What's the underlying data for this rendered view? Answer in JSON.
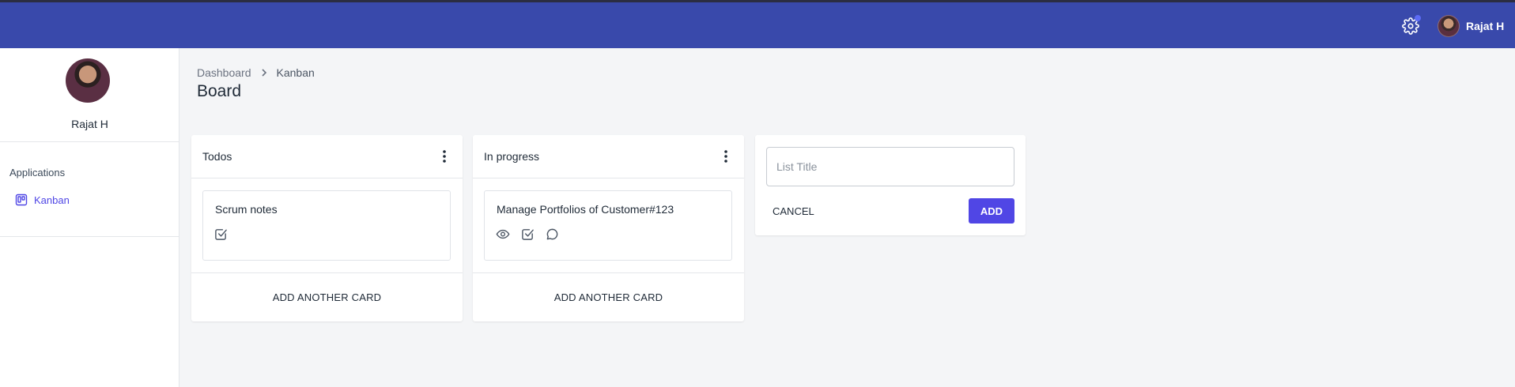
{
  "header": {
    "user_name": "Rajat H",
    "icons": [
      "gear-icon",
      "notification-dot"
    ],
    "accent_color": "#3949ab"
  },
  "sidebar": {
    "profile_name": "Rajat H",
    "section_label": "Applications",
    "items": [
      {
        "label": "Kanban",
        "icon": "kanban-board-icon"
      }
    ]
  },
  "breadcrumb": {
    "items": [
      "Dashboard",
      "Kanban"
    ]
  },
  "page": {
    "title": "Board"
  },
  "lists": [
    {
      "title": "Todos",
      "cards": [
        {
          "title": "Scrum notes",
          "icons": [
            "checkbox-icon"
          ]
        }
      ],
      "footer": "ADD ANOTHER CARD"
    },
    {
      "title": "In progress",
      "cards": [
        {
          "title": "Manage Portfolios of Customer#123",
          "icons": [
            "eye-icon",
            "checkbox-icon",
            "comment-icon"
          ]
        }
      ],
      "footer": "ADD ANOTHER CARD"
    }
  ],
  "new_list": {
    "placeholder": "List Title",
    "value": "",
    "cancel_label": "CANCEL",
    "add_label": "ADD",
    "add_color": "#5046e5"
  }
}
